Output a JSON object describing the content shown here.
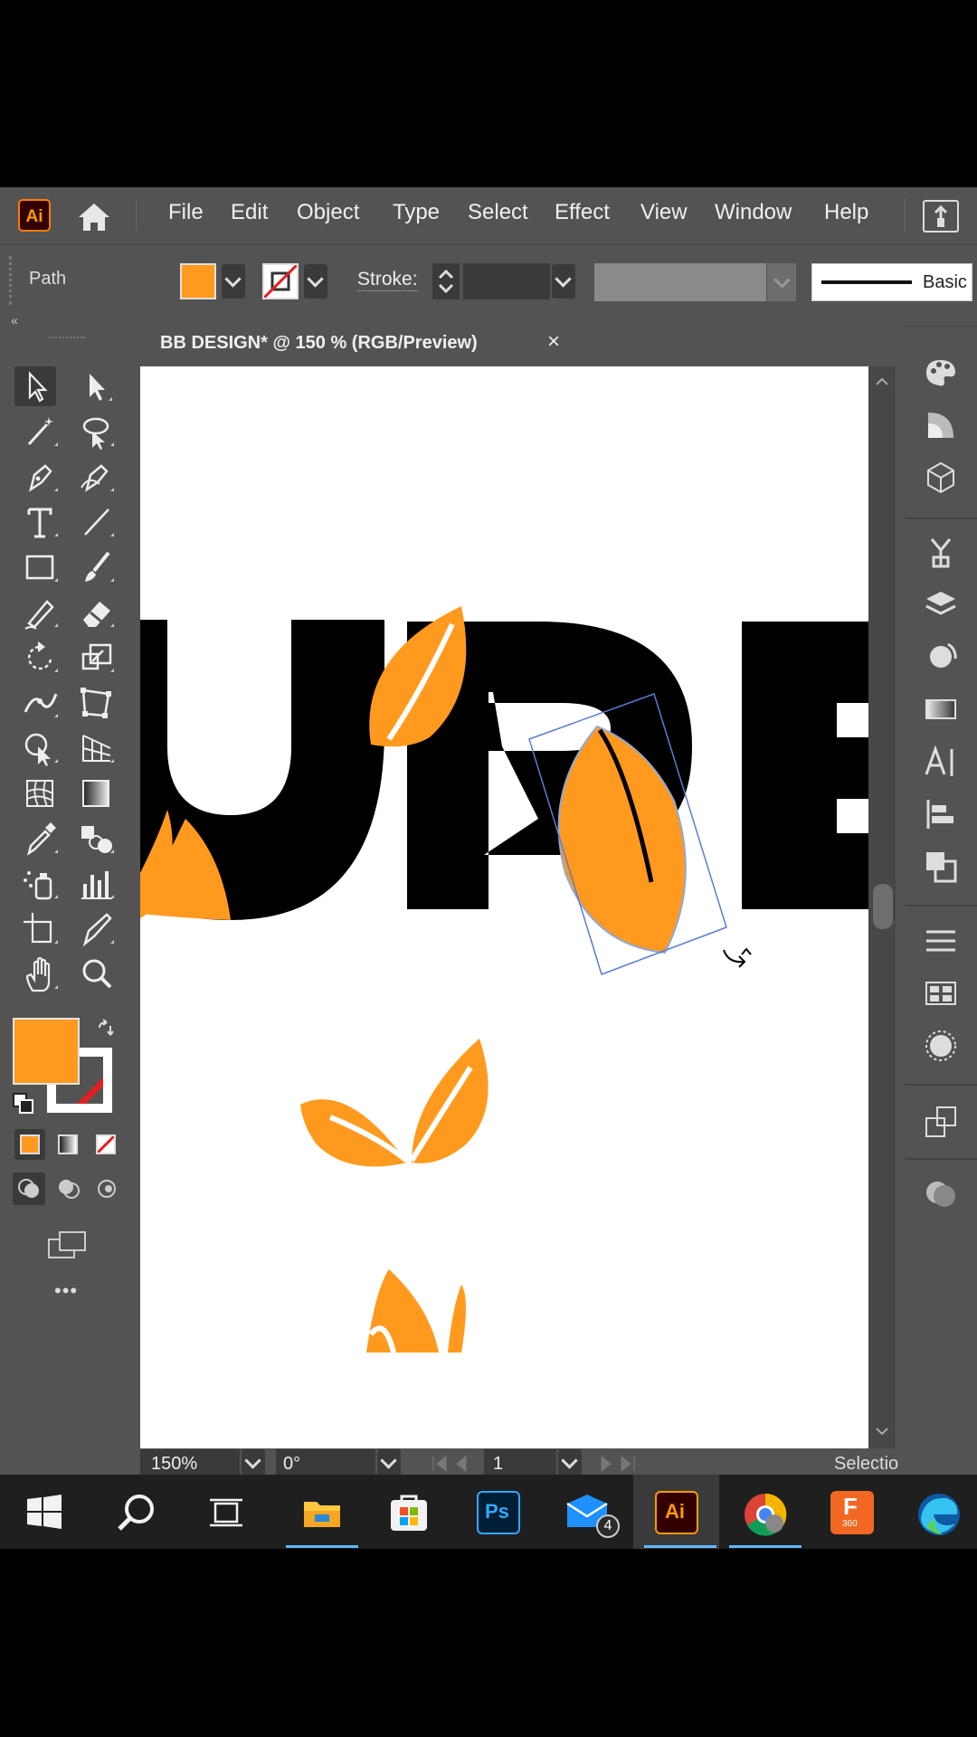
{
  "app": {
    "logo": "Ai",
    "menu": [
      "File",
      "Edit",
      "Object",
      "Type",
      "Select",
      "Effect",
      "View",
      "Window",
      "Help"
    ]
  },
  "control_bar": {
    "selection_type": "Path",
    "fill_color": "#ff9a1f",
    "stroke_label": "Stroke:",
    "brush_label": "Basic"
  },
  "document": {
    "tab_title": "BB DESIGN* @ 150 % (RGB/Preview)",
    "close": "×"
  },
  "status_bar": {
    "zoom": "150%",
    "rotation": "0°",
    "artboard": "1",
    "tool": "Selectio"
  },
  "toolbar": {
    "more": "•••"
  },
  "taskbar": {
    "mail_badge": "4",
    "ai_label": "Ai",
    "ps_label": "Ps",
    "f360_label": "F",
    "f360_sub": "360"
  },
  "colors": {
    "accent_orange": "#ff9a1f",
    "ui_bg": "#535353",
    "canvas": "#ffffff"
  }
}
